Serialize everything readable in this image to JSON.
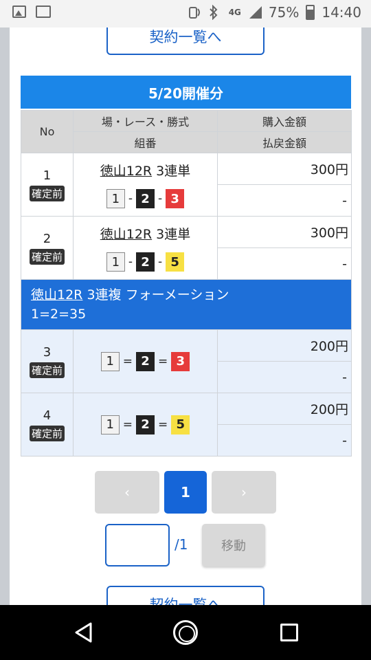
{
  "status_bar": {
    "network": "4G",
    "battery": "75%",
    "time": "14:40"
  },
  "top_button_label": "契約一覧へ",
  "bottom_button_label": "契約一覧へ",
  "day_header": "5/20開催分",
  "table_headers": {
    "no": "No",
    "race": "場・レース・勝式",
    "combination": "組番",
    "purchase": "購入金額",
    "payout": "払戻金額"
  },
  "rows": [
    {
      "no": "1",
      "status": "確定前",
      "venue": "徳山12R",
      "bet_type": "3連単",
      "n1": "1",
      "sep1": "-",
      "n2": "2",
      "sep2": "-",
      "n3": "3",
      "amount": "300円",
      "payout": "-"
    },
    {
      "no": "2",
      "status": "確定前",
      "venue": "徳山12R",
      "bet_type": "3連単",
      "n1": "1",
      "sep1": "-",
      "n2": "2",
      "sep2": "-",
      "n3": "5",
      "amount": "300円",
      "payout": "-"
    }
  ],
  "formation": {
    "venue": "徳山12R",
    "label": "3連複 フォーメーション",
    "combo": "1=2=35"
  },
  "formation_rows": [
    {
      "no": "3",
      "status": "確定前",
      "n1": "1",
      "sep1": "=",
      "n2": "2",
      "sep2": "=",
      "n3": "3",
      "amount": "200円",
      "payout": "-"
    },
    {
      "no": "4",
      "status": "確定前",
      "n1": "1",
      "sep1": "=",
      "n2": "2",
      "sep2": "=",
      "n3": "5",
      "amount": "200円",
      "payout": "-"
    }
  ],
  "pagination": {
    "prev": "‹",
    "current": "1",
    "next": "›",
    "total": "/1",
    "move_label": "移動",
    "input_value": ""
  },
  "colors": {
    "primary": "#1b86e8",
    "formation_header": "#1e6fd8",
    "num2": "#222222",
    "num3": "#e63b3b",
    "num5": "#f7e043"
  }
}
